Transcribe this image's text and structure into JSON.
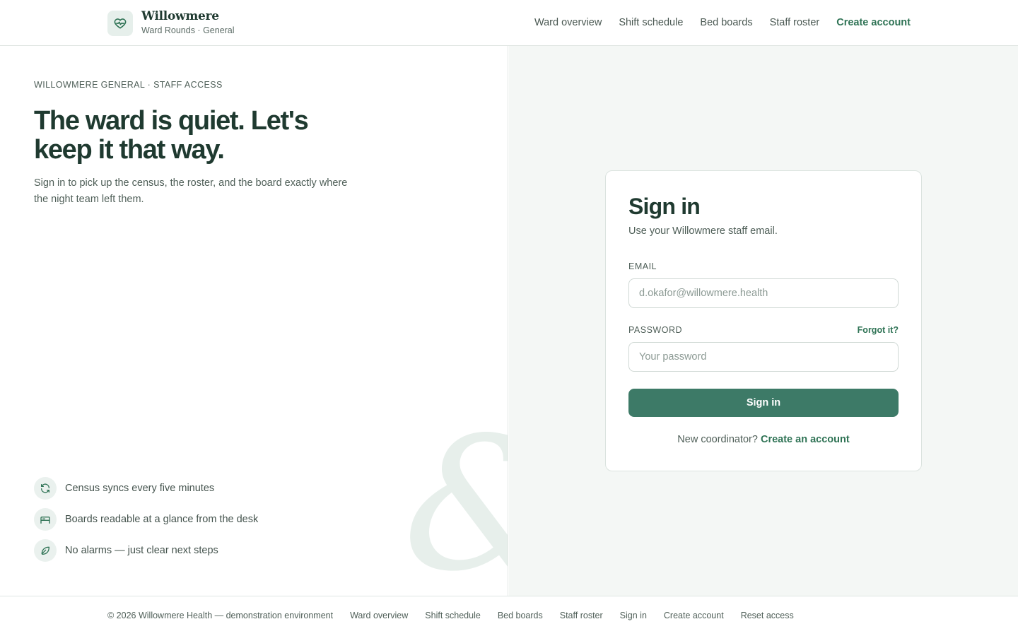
{
  "header": {
    "brand_name": "Willowmere",
    "brand_sub": "Ward Rounds · General",
    "nav": [
      "Ward overview",
      "Shift schedule",
      "Bed boards",
      "Staff roster"
    ],
    "create_account": "Create account"
  },
  "hero": {
    "eyebrow": "WILLOWMERE GENERAL · STAFF ACCESS",
    "headline": "The ward is quiet. Let's keep it that way.",
    "lede": "Sign in to pick up the census, the roster, and the board exactly where the night team left them.",
    "decor_glyph": "&",
    "features": [
      {
        "icon": "refresh-icon",
        "text": "Census syncs every five minutes"
      },
      {
        "icon": "bed-icon",
        "text": "Boards readable at a glance from the desk"
      },
      {
        "icon": "leaf-icon",
        "text": "No alarms — just clear next steps"
      }
    ]
  },
  "signin": {
    "title": "Sign in",
    "subtitle": "Use your Willowmere staff email.",
    "email_label": "EMAIL",
    "email_placeholder": "d.okafor@willowmere.health",
    "password_label": "PASSWORD",
    "forgot": "Forgot it?",
    "password_placeholder": "Your password",
    "submit": "Sign in",
    "signup_prompt": "New coordinator?",
    "signup_link": "Create an account"
  },
  "footer": {
    "copyright": "© 2026 Willowmere Health — demonstration environment",
    "links": [
      "Ward overview",
      "Shift schedule",
      "Bed boards",
      "Staff roster",
      "Sign in",
      "Create account",
      "Reset access"
    ]
  },
  "colors": {
    "accent": "#2f7355",
    "button": "#3d7a67",
    "ink": "#1f3a30",
    "panel_bg": "#f4f7f5"
  }
}
